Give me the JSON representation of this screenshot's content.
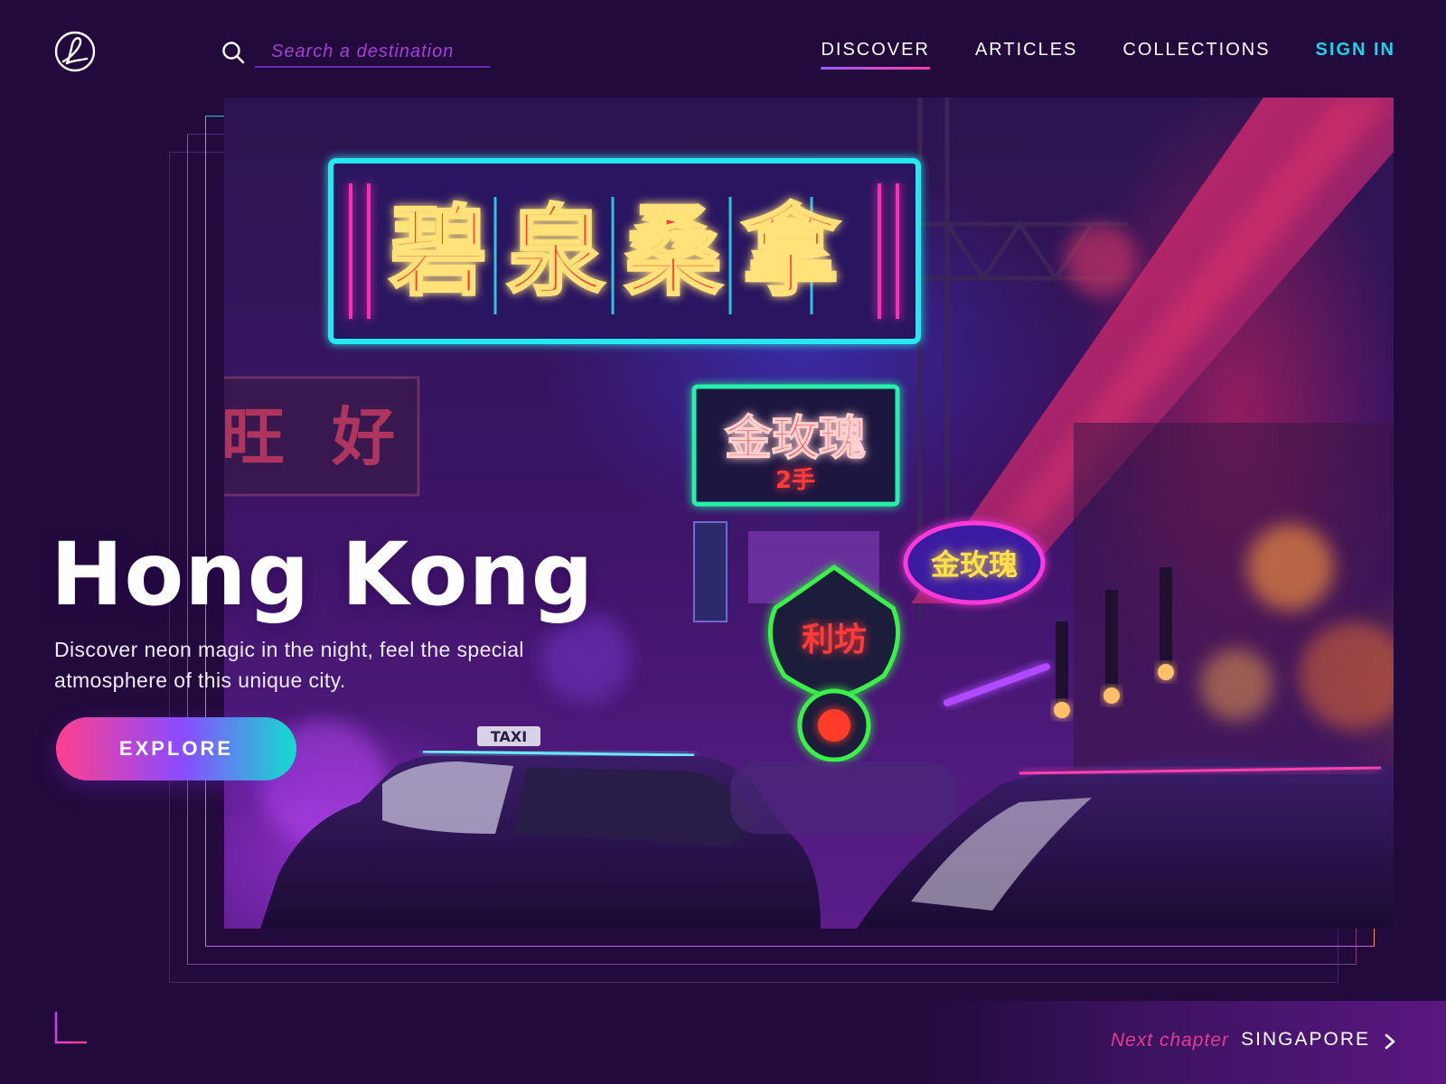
{
  "header": {
    "logo_icon": "script-l-logo-icon",
    "search": {
      "icon": "search-icon",
      "placeholder": "Search a destination",
      "value": ""
    },
    "nav": [
      {
        "label": "DISCOVER",
        "active": true
      },
      {
        "label": "ARTICLES",
        "active": false
      },
      {
        "label": "COLLECTIONS",
        "active": false
      }
    ],
    "sign_in_label": "SIGN IN"
  },
  "hero": {
    "title": "Hong Kong",
    "description": "Discover neon magic in the night, feel the special atmosphere of this unique city.",
    "explore_label": "EXPLORE",
    "illustration": {
      "main_sign": "碧泉桑拿",
      "left_sign": "旺 好",
      "center_sign": "金玫瑰",
      "center_sign_sub": "2手",
      "oval_sign": "金玫瑰",
      "shield_sign": "利坊",
      "taxi_sign": "TAXI"
    }
  },
  "footer": {
    "corner_icon": "corner-bracket-icon",
    "next_label": "Next chapter",
    "next_city": "SINGAPORE",
    "next_icon": "chevron-right-icon"
  },
  "colors": {
    "background": "#230a3d",
    "accent_cyan": "#19d6e6",
    "accent_pink": "#ff3f8e",
    "accent_purple": "#8b4bff",
    "next_label": "#e23d92"
  }
}
